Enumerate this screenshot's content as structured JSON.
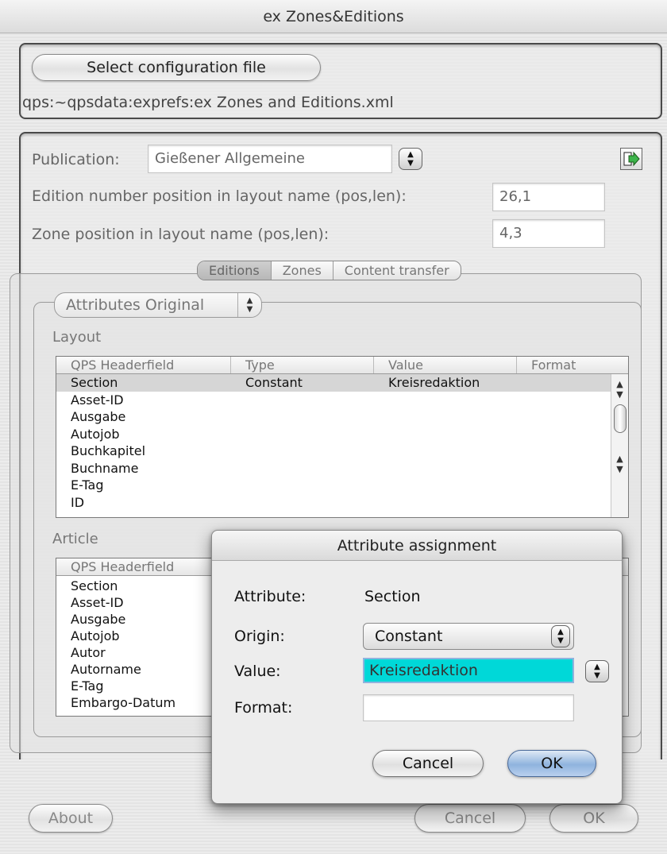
{
  "window": {
    "title": "ex Zones&Editions"
  },
  "config": {
    "select_button": "Select configuration file",
    "path": "qps:~qpsdata:exprefs:ex Zones and Editions.xml"
  },
  "settings": {
    "publication_label": "Publication:",
    "publication_value": "Gießener Allgemeine",
    "edition_label": "Edition number position in layout name (pos,len):",
    "edition_value": "26,1",
    "zone_label": "Zone position in layout name (pos,len):",
    "zone_value": "4,3",
    "export_icon": "export-arrow-icon"
  },
  "tabs": [
    {
      "label": "Editions",
      "selected": true
    },
    {
      "label": "Zones",
      "selected": false
    },
    {
      "label": "Content transfer",
      "selected": false
    }
  ],
  "attributes_popup": {
    "selected": "Attributes Original"
  },
  "layout_table": {
    "caption": "Layout",
    "columns": [
      "QPS Headerfield",
      "Type",
      "Value",
      "Format"
    ],
    "rows": [
      {
        "field": "Section",
        "type": "Constant",
        "value": "Kreisredaktion",
        "format": "",
        "selected": true
      },
      {
        "field": "Asset-ID",
        "type": "",
        "value": "",
        "format": ""
      },
      {
        "field": "Ausgabe",
        "type": "",
        "value": "",
        "format": ""
      },
      {
        "field": "Autojob",
        "type": "",
        "value": "",
        "format": ""
      },
      {
        "field": "Buchkapitel",
        "type": "",
        "value": "",
        "format": ""
      },
      {
        "field": "Buchname",
        "type": "",
        "value": "",
        "format": ""
      },
      {
        "field": "E-Tag",
        "type": "",
        "value": "",
        "format": ""
      },
      {
        "field": "ID",
        "type": "",
        "value": "",
        "format": ""
      }
    ]
  },
  "article_table": {
    "caption": "Article",
    "columns": [
      "QPS Headerfield"
    ],
    "rows": [
      "Section",
      "Asset-ID",
      "Ausgabe",
      "Autojob",
      "Autor",
      "Autorname",
      "E-Tag",
      "Embargo-Datum"
    ]
  },
  "footer": {
    "about": "About",
    "cancel": "Cancel",
    "ok": "OK"
  },
  "dialog": {
    "title": "Attribute assignment",
    "attribute_label": "Attribute:",
    "attribute_value": "Section",
    "origin_label": "Origin:",
    "origin_value": "Constant",
    "value_label": "Value:",
    "value_value": "Kreisredaktion",
    "format_label": "Format:",
    "format_value": "",
    "cancel": "Cancel",
    "ok": "OK",
    "colors": {
      "value_highlight": "#00d8d8",
      "ok_button": "#8fb3de"
    }
  }
}
